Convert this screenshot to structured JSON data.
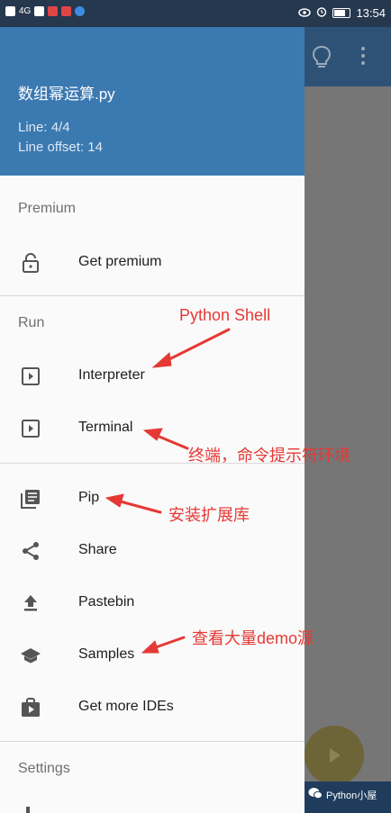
{
  "status_bar": {
    "left_text": "4G",
    "time": "13:54",
    "battery": "100"
  },
  "drawer": {
    "header": {
      "file_name": "数组幂运算.py",
      "line": "Line: 4/4",
      "line_offset": "Line offset: 14"
    },
    "sections": {
      "premium": {
        "title": "Premium",
        "items": [
          {
            "label": "Get premium",
            "icon": "lock-icon"
          }
        ]
      },
      "run": {
        "title": "Run",
        "items": [
          {
            "label": "Interpreter",
            "icon": "play-box-icon"
          },
          {
            "label": "Terminal",
            "icon": "play-box-icon"
          }
        ]
      },
      "tools": {
        "items": [
          {
            "label": "Pip",
            "icon": "library-books-icon"
          },
          {
            "label": "Share",
            "icon": "share-icon"
          },
          {
            "label": "Pastebin",
            "icon": "upload-icon"
          },
          {
            "label": "Samples",
            "icon": "school-icon"
          },
          {
            "label": "Get more IDEs",
            "icon": "shop-icon"
          }
        ]
      },
      "settings": {
        "title": "Settings"
      }
    }
  },
  "annotations": {
    "python_shell": "Python Shell",
    "terminal": "终端，命令提示符环境",
    "pip": "安装扩展库",
    "samples": "查看大量demo源"
  },
  "watermark": "Python小屋",
  "colors": {
    "header": "#3b79b1",
    "annotation": "#e53935",
    "fab": "#6d6438"
  }
}
